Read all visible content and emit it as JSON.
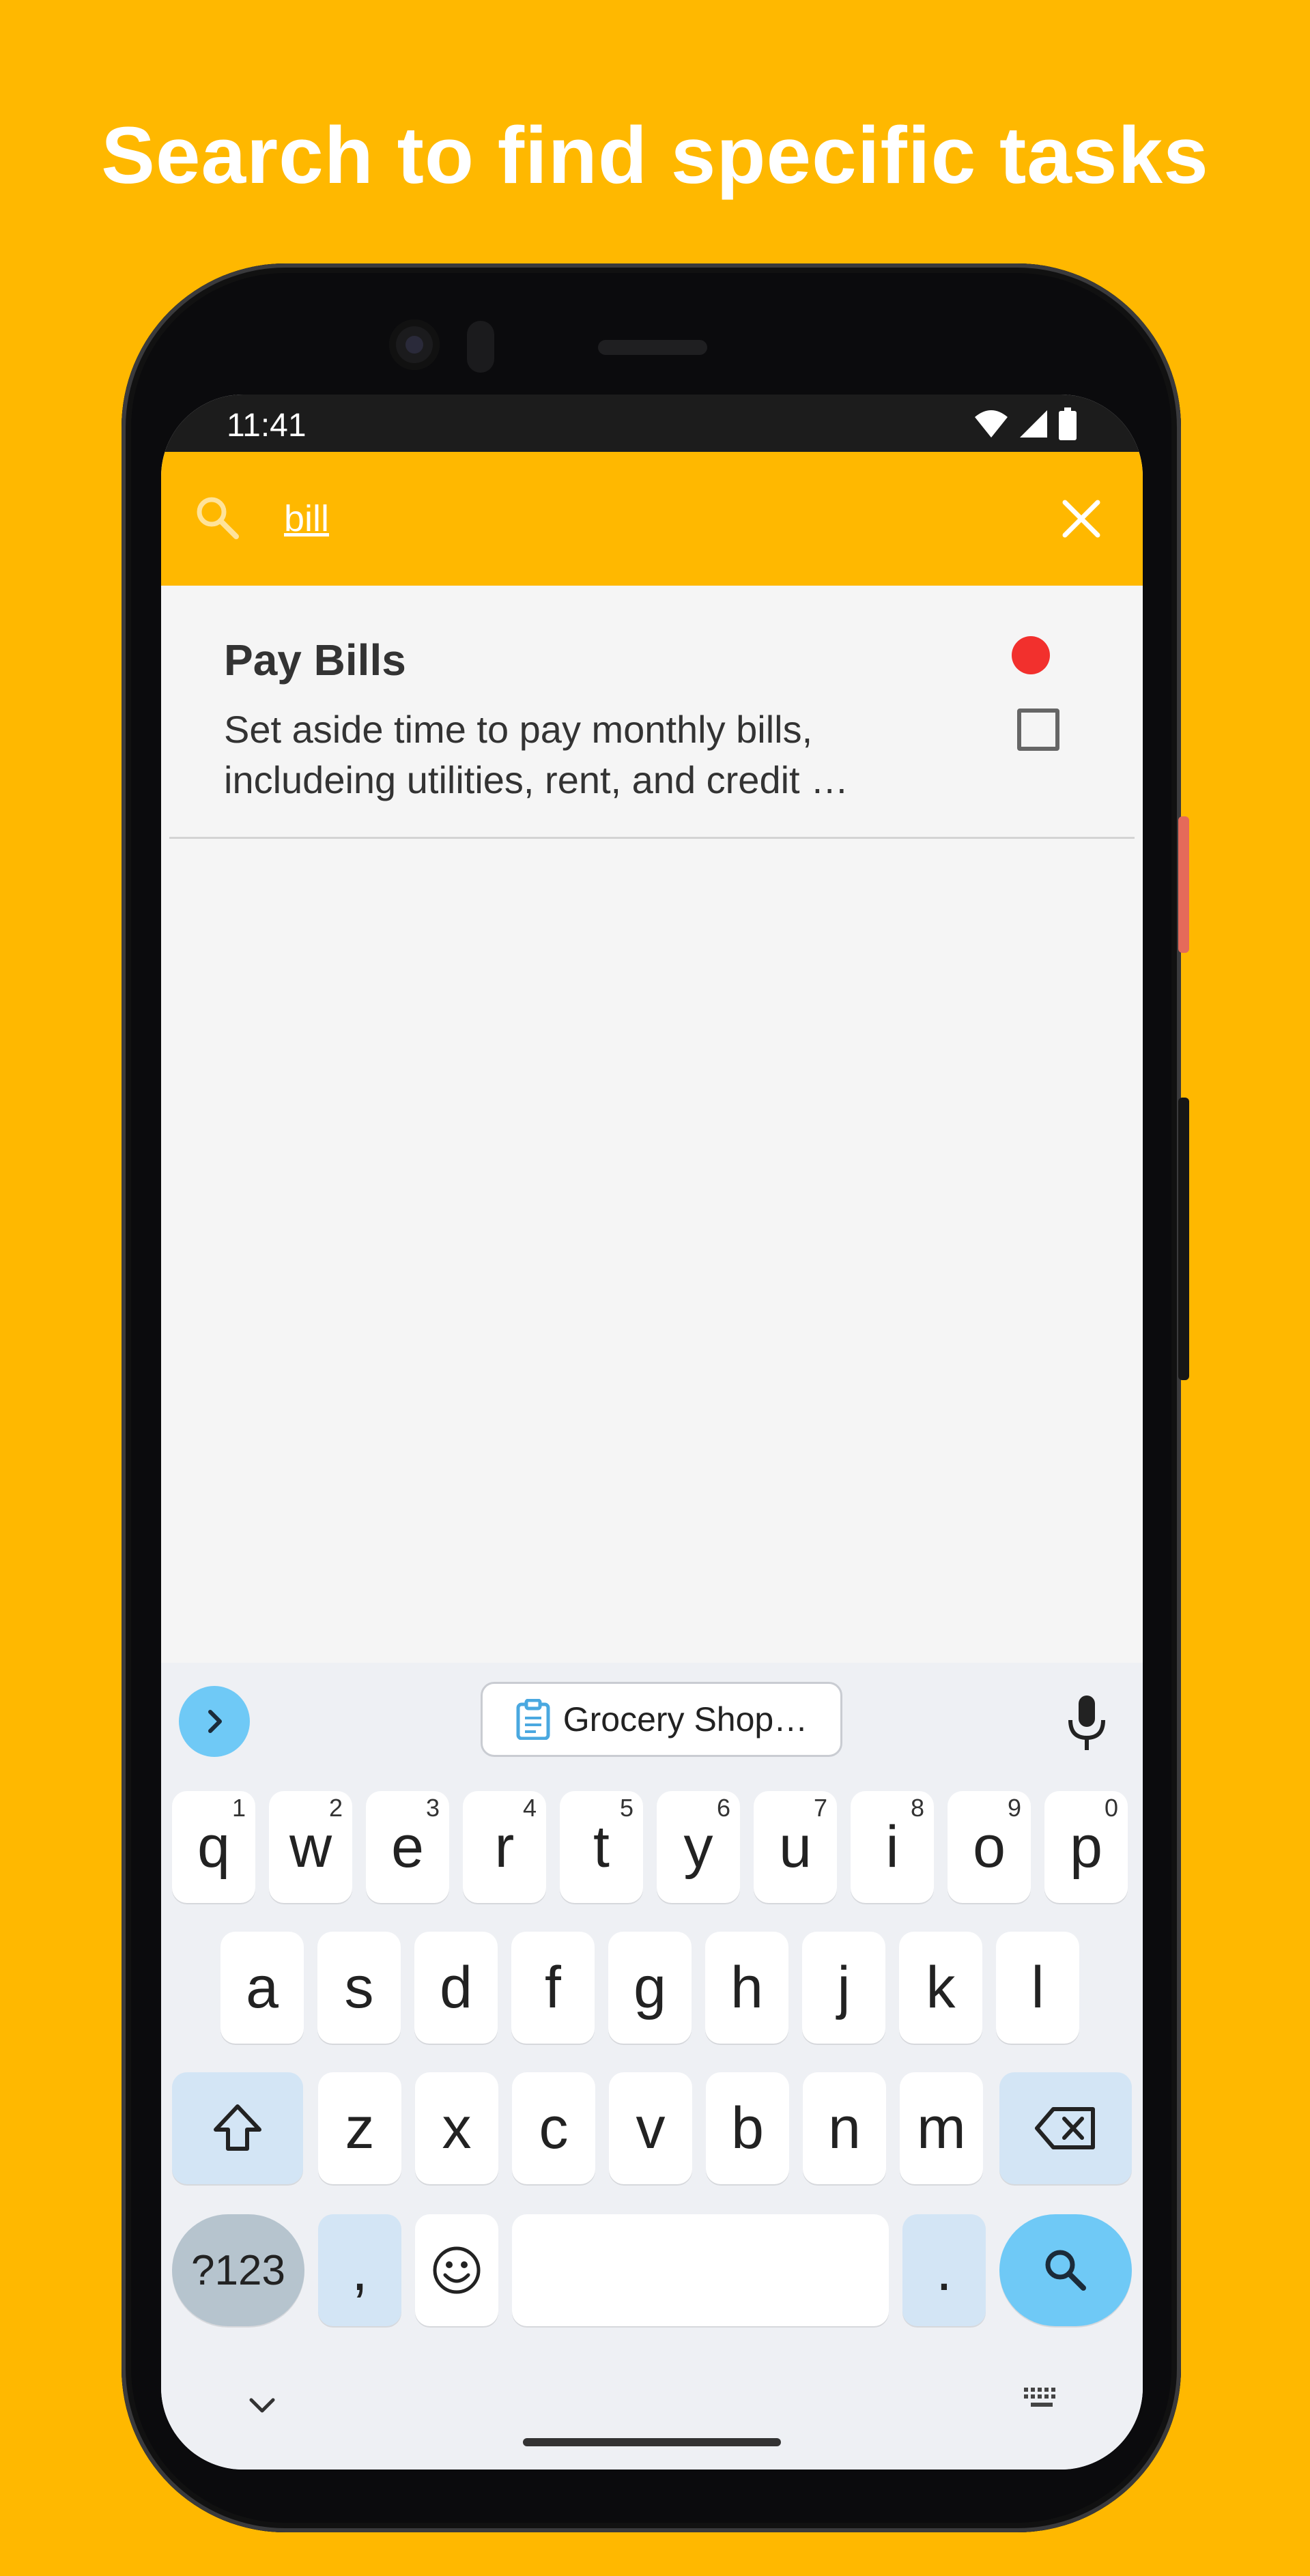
{
  "headline": "Search to find specific tasks",
  "status_bar": {
    "time": "11:41",
    "icons": [
      "wifi-icon",
      "signal-icon",
      "battery-icon"
    ]
  },
  "search": {
    "query": "bill",
    "icon": "search-icon",
    "close_icon": "close-icon"
  },
  "tasks": [
    {
      "title": "Pay Bills",
      "description_line1": "Set aside time to pay monthly bills,",
      "description_line2": "includeing utilities, rent, and credit …",
      "priority_color": "#F2302D",
      "checked": false
    }
  ],
  "keyboard": {
    "clipboard_suggestion": "Grocery Shop…",
    "row1": [
      {
        "key": "q",
        "hint": "1"
      },
      {
        "key": "w",
        "hint": "2"
      },
      {
        "key": "e",
        "hint": "3"
      },
      {
        "key": "r",
        "hint": "4"
      },
      {
        "key": "t",
        "hint": "5"
      },
      {
        "key": "y",
        "hint": "6"
      },
      {
        "key": "u",
        "hint": "7"
      },
      {
        "key": "i",
        "hint": "8"
      },
      {
        "key": "o",
        "hint": "9"
      },
      {
        "key": "p",
        "hint": "0"
      }
    ],
    "row2": [
      "a",
      "s",
      "d",
      "f",
      "g",
      "h",
      "j",
      "k",
      "l"
    ],
    "row3": [
      "z",
      "x",
      "c",
      "v",
      "b",
      "n",
      "m"
    ],
    "symbols_label": "?123",
    "comma": ",",
    "period": "."
  },
  "colors": {
    "accent": "#FFB800",
    "keyboard_action": "#6FC9F6",
    "priority_high": "#F2302D"
  }
}
